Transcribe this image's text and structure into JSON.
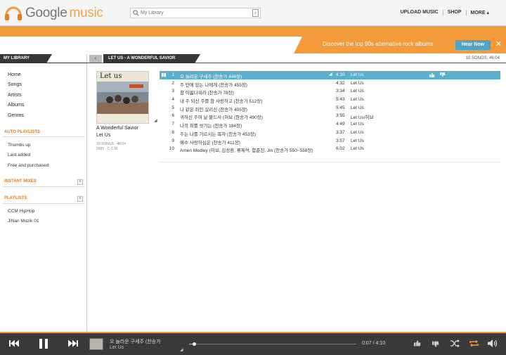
{
  "app": {
    "logo_word1": "Google",
    "logo_word2": "music"
  },
  "search": {
    "placeholder": "My Library",
    "button_glyph": "›"
  },
  "topnav": {
    "upload": "UPLOAD MUSIC",
    "shop": "SHOP",
    "more": "MORE ▴"
  },
  "promo": {
    "text": "Discover the top 90s alternative rock albums",
    "button": "Hear Now",
    "close": "✕"
  },
  "sidebar": {
    "header": "MY LIBRARY",
    "items": [
      "Home",
      "Songs",
      "Artists",
      "Albums",
      "Genres"
    ],
    "auto_playlists": {
      "header": "AUTO PLAYLISTS",
      "items": [
        "Thumbs up",
        "Last added",
        "Free and purchased"
      ]
    },
    "instant_mixes": {
      "header": "INSTANT MIXES",
      "plus": "+"
    },
    "playlists": {
      "header": "PLAYLISTS",
      "plus": "+",
      "items": [
        "CCM HipHop",
        "JiNan Muzik 01"
      ]
    }
  },
  "main": {
    "back": "‹",
    "title": "LET US - A WONDERFUL SAVIOR",
    "count": "10 SONGS, 46:04"
  },
  "album": {
    "art_text": "Let us",
    "title": "A Wonderful Savior",
    "artist": "Let Us",
    "meta_line1": "10 SONGS  ·  46:04",
    "meta_line2": "2005  ·  C.C.M."
  },
  "tracks": [
    {
      "num": "1",
      "title": "오 놀라운 구세주 (찬송가 446장)",
      "dur": "4:10",
      "artist": "Let Us",
      "selected": true
    },
    {
      "num": "2",
      "title": "주 안에 있는 나에게 (찬송가 455장)",
      "dur": "4:32",
      "artist": "Let Us"
    },
    {
      "num": "3",
      "title": "참 아름다워라 (찬송가 78장)",
      "dur": "3:34",
      "artist": "Let Us"
    },
    {
      "num": "4",
      "title": "내 주 되신 주를 참 사랑하고 (찬송가 512장)",
      "dur": "5:43",
      "artist": "Let Us"
    },
    {
      "num": "5",
      "title": "나 같은 죄인 살리신 (찬송가 405장)",
      "dur": "5:45",
      "artist": "Let Us"
    },
    {
      "num": "6",
      "title": "귀하신 주여 날 붙드사 (허브 (찬송가 490장)",
      "dur": "3:55",
      "artist": "Let Us/허브"
    },
    {
      "num": "7",
      "title": "나의 죄를 씻기는 (찬송가 184장)",
      "dur": "4:49",
      "artist": "Let Us"
    },
    {
      "num": "8",
      "title": "주는 나를 기르시는 목자 (찬송가 453장)",
      "dur": "3:37",
      "artist": "Let Us"
    },
    {
      "num": "9",
      "title": "예수 사랑하심은 (찬송가 411장)",
      "dur": "3:57",
      "artist": "Let Us"
    },
    {
      "num": "10",
      "title": "Amen Medley (허브, 김성환, 류제석, 함준진, Jin (찬송가 550~558장)",
      "dur": "6:02",
      "artist": "Let Us"
    }
  ],
  "player": {
    "now_title": "오 놀라운 구세주 (찬송가",
    "now_artist": "Let Us",
    "time": "0:07 / 4:10",
    "progress_fraction": 0.028
  },
  "colors": {
    "accent": "#f39a3b",
    "selected_row": "#5ab0cc",
    "dark": "#363636"
  }
}
